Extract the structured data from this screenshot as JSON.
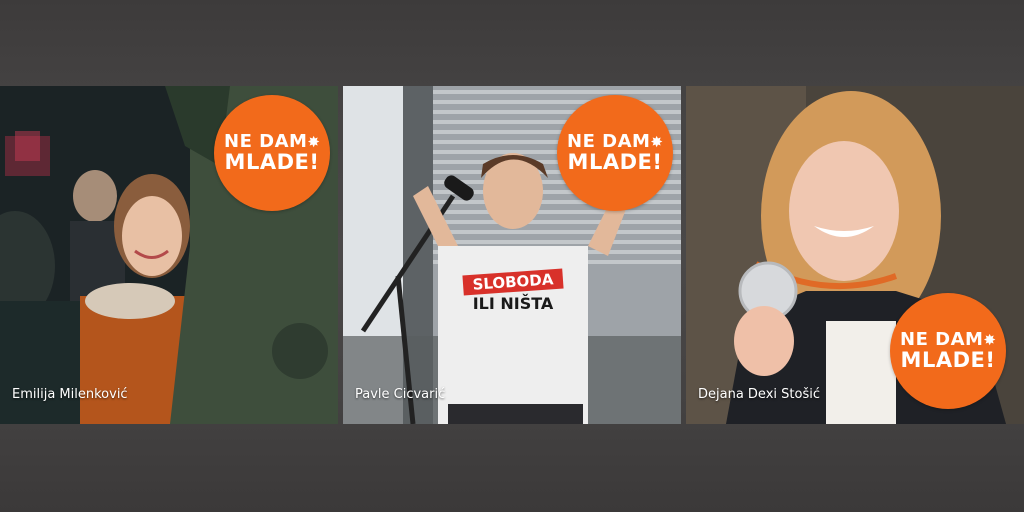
{
  "colors": {
    "background": "#444242",
    "badge": "#f26a1b",
    "caption": "#ffffff"
  },
  "panels": [
    {
      "caption": "Emilija Milenković",
      "badge": {
        "line1": "NE DAM",
        "burst": "✸",
        "line2": "MLADE!"
      }
    },
    {
      "caption": "Pavle Cicvarić",
      "badge": {
        "line1": "NE DAM",
        "burst": "✸",
        "line2": "MLADE!"
      },
      "shirt": {
        "line1": "SLOBODA",
        "line2": "ILI NIŠTA"
      }
    },
    {
      "caption": "Dejana Dexi Stošić",
      "badge": {
        "line1": "NE DAM",
        "burst": "✸",
        "line2": "MLADE!"
      }
    }
  ]
}
